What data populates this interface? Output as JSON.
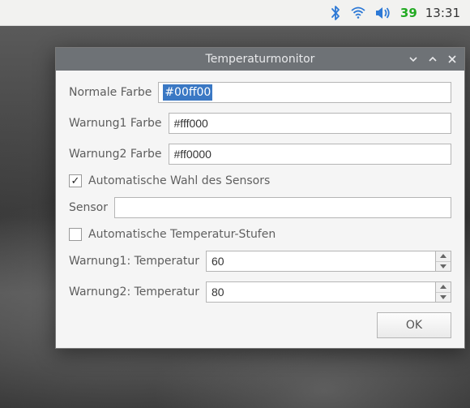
{
  "panel": {
    "temp": "39",
    "clock": "13:31"
  },
  "dialog": {
    "title": "Temperaturmonitor",
    "rows": {
      "normal_label": "Normale Farbe",
      "normal_value": "#00ff00",
      "warn1_label": "Warnung1 Farbe",
      "warn1_value": "#fff000",
      "warn2_label": "Warnung2 Farbe",
      "warn2_value": "#ff0000",
      "auto_sensor_label": "Automatische Wahl des Sensors",
      "auto_sensor_checked": true,
      "sensor_label": "Sensor",
      "sensor_value": "",
      "auto_levels_label": "Automatische Temperatur-Stufen",
      "auto_levels_checked": false,
      "warn1_temp_label": "Warnung1: Temperatur",
      "warn1_temp_value": "60",
      "warn2_temp_label": "Warnung2: Temperatur",
      "warn2_temp_value": "80"
    },
    "ok_label": "OK"
  }
}
